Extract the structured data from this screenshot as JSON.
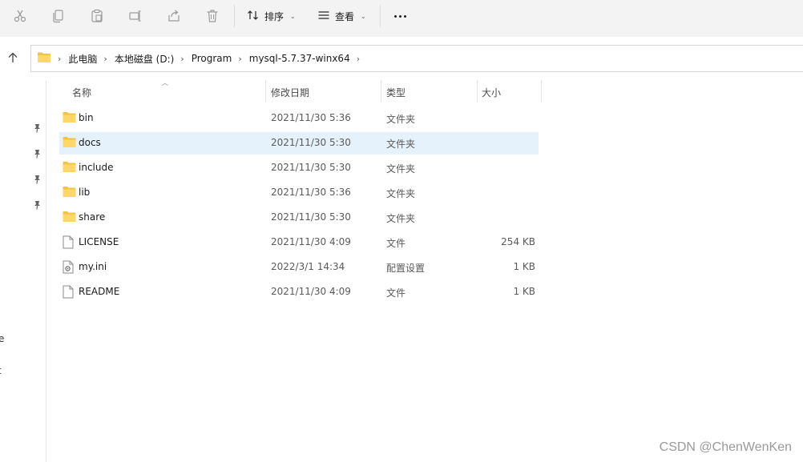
{
  "toolbar": {
    "icons": [
      "cut-icon",
      "copy-icon",
      "paste-icon",
      "rename-icon",
      "share-icon",
      "delete-icon"
    ],
    "sort_label": "排序",
    "view_label": "查看"
  },
  "address": {
    "crumbs": [
      "此电脑",
      "本地磁盘 (D:)",
      "Program",
      "mysql-5.7.37-winx64"
    ]
  },
  "nav": {
    "fragments": [
      "e",
      "t"
    ]
  },
  "columns": {
    "name": "名称",
    "date": "修改日期",
    "type": "类型",
    "size": "大小"
  },
  "files": [
    {
      "name": "bin",
      "date": "2021/11/30 5:36",
      "type": "文件夹",
      "size": "",
      "icon": "folder-icon",
      "selected": false
    },
    {
      "name": "docs",
      "date": "2021/11/30 5:30",
      "type": "文件夹",
      "size": "",
      "icon": "folder-icon",
      "selected": true
    },
    {
      "name": "include",
      "date": "2021/11/30 5:30",
      "type": "文件夹",
      "size": "",
      "icon": "folder-icon",
      "selected": false
    },
    {
      "name": "lib",
      "date": "2021/11/30 5:36",
      "type": "文件夹",
      "size": "",
      "icon": "folder-icon",
      "selected": false
    },
    {
      "name": "share",
      "date": "2021/11/30 5:30",
      "type": "文件夹",
      "size": "",
      "icon": "folder-icon",
      "selected": false
    },
    {
      "name": "LICENSE",
      "date": "2021/11/30 4:09",
      "type": "文件",
      "size": "254 KB",
      "icon": "file-icon",
      "selected": false
    },
    {
      "name": "my.ini",
      "date": "2022/3/1 14:34",
      "type": "配置设置",
      "size": "1 KB",
      "icon": "settings-file-icon",
      "selected": false
    },
    {
      "name": "README",
      "date": "2021/11/30 4:09",
      "type": "文件",
      "size": "1 KB",
      "icon": "file-icon",
      "selected": false
    }
  ],
  "watermark": "CSDN @ChenWenKen",
  "colors": {
    "toolbar_bg": "#f3f3f3",
    "selected_row": "#e5f1fb",
    "folder_yellow": "#f5c343"
  }
}
